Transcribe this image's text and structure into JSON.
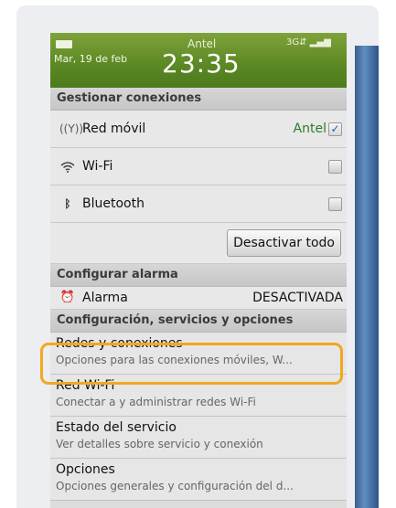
{
  "status_bar": {
    "carrier": "Antel",
    "signal": "3G",
    "date": "Mar, 19 de feb",
    "time": "23:35"
  },
  "connections": {
    "header": "Gestionar conexiones",
    "mobile": {
      "label": "Red móvil",
      "value": "Antel",
      "checked": true
    },
    "wifi": {
      "label": "Wi-Fi",
      "checked": false
    },
    "bluetooth": {
      "label": "Bluetooth",
      "checked": false
    },
    "disable_all": "Desactivar todo"
  },
  "alarm": {
    "header": "Configurar alarma",
    "label": "Alarma",
    "value": "DESACTIVADA"
  },
  "options": {
    "header": "Configuración, servicios y opciones",
    "items": [
      {
        "title": "Redes y conexiones",
        "subtitle": "Opciones para las conexiones móviles, W..."
      },
      {
        "title": "Red Wi-Fi",
        "subtitle": "Conectar a y administrar redes Wi-Fi"
      },
      {
        "title": "Estado del servicio",
        "subtitle": "Ver detalles sobre servicio y conexión"
      },
      {
        "title": "Opciones",
        "subtitle": "Opciones generales y configuración del d..."
      }
    ]
  },
  "colors": {
    "status_bar": "#5d8a25",
    "highlight": "#f0a820",
    "active_value": "#2c7a2c"
  }
}
